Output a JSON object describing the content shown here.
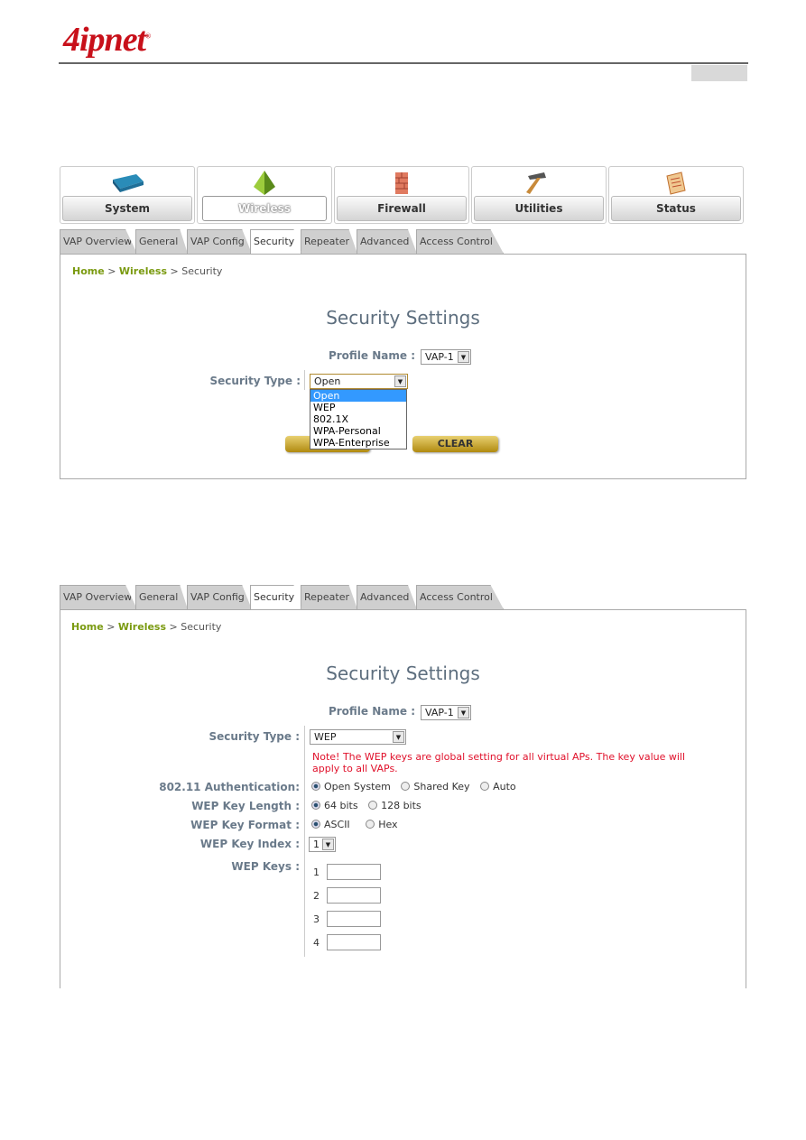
{
  "logo": "4ipnet",
  "nav": [
    {
      "label": "System",
      "icon": "router-icon"
    },
    {
      "label": "Wireless",
      "icon": "wireless-pyramid-icon",
      "active": true
    },
    {
      "label": "Firewall",
      "icon": "firewall-brick-icon"
    },
    {
      "label": "Utilities",
      "icon": "hammer-icon"
    },
    {
      "label": "Status",
      "icon": "status-document-icon"
    }
  ],
  "tabs": [
    "VAP Overview",
    "General",
    "VAP Config",
    "Security",
    "Repeater",
    "Advanced",
    "Access Control"
  ],
  "active_tab": "Security",
  "breadcrumb": {
    "home": "Home",
    "sep": ">",
    "section": "Wireless",
    "page": "Security"
  },
  "panel1": {
    "title": "Security Settings",
    "profile_label": "Profile Name :",
    "profile_value": "VAP-1",
    "security_label": "Security Type :",
    "security_value": "Open",
    "options": [
      "Open",
      "WEP",
      "802.1X",
      "WPA-Personal",
      "WPA-Enterprise"
    ],
    "highlighted": "Open",
    "clear": "CLEAR"
  },
  "panel2": {
    "title": "Security Settings",
    "profile_label": "Profile Name :",
    "profile_value": "VAP-1",
    "security_label": "Security Type :",
    "security_value": "WEP",
    "note1": "Note! The WEP keys are global setting for all virtual APs. The key value will",
    "note2": "apply to all VAPs.",
    "auth_label": "802.11 Authentication:",
    "auth_options": [
      "Open System",
      "Shared Key",
      "Auto"
    ],
    "auth_selected": "Open System",
    "len_label": "WEP Key Length :",
    "len_options": [
      "64 bits",
      "128 bits"
    ],
    "len_selected": "64 bits",
    "fmt_label": "WEP Key Format :",
    "fmt_options": [
      "ASCII",
      "Hex"
    ],
    "fmt_selected": "ASCII",
    "idx_label": "WEP Key Index :",
    "idx_value": "1",
    "keys_label": "WEP Keys :",
    "keys": [
      {
        "n": "1",
        "value": ""
      },
      {
        "n": "2",
        "value": ""
      },
      {
        "n": "3",
        "value": ""
      },
      {
        "n": "4",
        "value": ""
      }
    ]
  },
  "colors": {
    "brand": "#c8101a",
    "link": "#7a9a10",
    "note": "#e0102a"
  }
}
